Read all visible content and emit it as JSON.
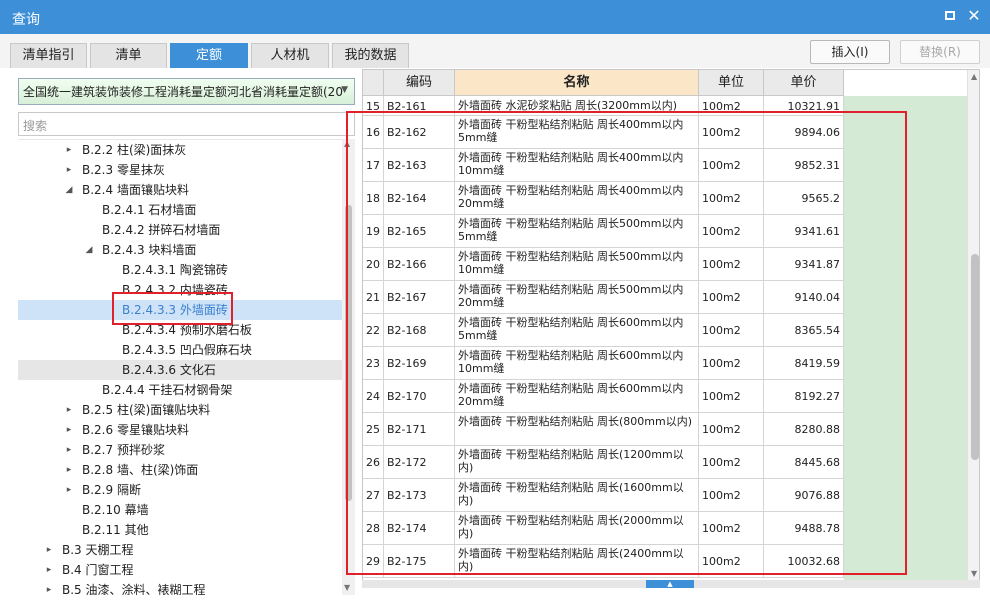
{
  "window": {
    "title": "查询"
  },
  "tabs": [
    {
      "label": "清单指引",
      "active": false
    },
    {
      "label": "清单",
      "active": false
    },
    {
      "label": "定额",
      "active": true
    },
    {
      "label": "人材机",
      "active": false
    },
    {
      "label": "我的数据",
      "active": false
    }
  ],
  "actions": {
    "insert_label": "插入(I)",
    "replace_label": "替换(R)"
  },
  "library": {
    "selected": "全国统一建筑装饰装修工程消耗量定额河北省消耗量定额(20"
  },
  "search": {
    "placeholder": "搜索"
  },
  "tree": [
    {
      "label": "B.2.2 柱(梁)面抹灰",
      "caret": "▸",
      "level": 2
    },
    {
      "label": "B.2.3 零星抹灰",
      "caret": "▸",
      "level": 2
    },
    {
      "label": "B.2.4 墙面镶贴块料",
      "caret": "◢",
      "level": 2
    },
    {
      "label": "B.2.4.1 石材墙面",
      "caret": "",
      "level": 3
    },
    {
      "label": "B.2.4.2 拼碎石材墙面",
      "caret": "",
      "level": 3
    },
    {
      "label": "B.2.4.3 块料墙面",
      "caret": "◢",
      "level": 3
    },
    {
      "label": "B.2.4.3.1 陶瓷锦砖",
      "caret": "",
      "level": 4
    },
    {
      "label": "B.2.4.3.2 内墙瓷砖",
      "caret": "",
      "level": 4
    },
    {
      "label": "B.2.4.3.3 外墙面砖",
      "caret": "",
      "level": 4,
      "selected": true
    },
    {
      "label": "B.2.4.3.4 预制水磨石板",
      "caret": "",
      "level": 4
    },
    {
      "label": "B.2.4.3.5 凹凸假麻石块",
      "caret": "",
      "level": 4
    },
    {
      "label": "B.2.4.3.6 文化石",
      "caret": "",
      "level": 4,
      "hover": true
    },
    {
      "label": "B.2.4.4 干挂石材钢骨架",
      "caret": "",
      "level": 3
    },
    {
      "label": "B.2.5 柱(梁)面镶贴块料",
      "caret": "▸",
      "level": 2
    },
    {
      "label": "B.2.6 零星镶贴块料",
      "caret": "▸",
      "level": 2
    },
    {
      "label": "B.2.7 预拌砂浆",
      "caret": "▸",
      "level": 2
    },
    {
      "label": "B.2.8 墙、柱(梁)饰面",
      "caret": "▸",
      "level": 2
    },
    {
      "label": "B.2.9 隔断",
      "caret": "▸",
      "level": 2
    },
    {
      "label": "B.2.10 幕墙",
      "caret": "",
      "level": 2
    },
    {
      "label": "B.2.11 其他",
      "caret": "",
      "level": 2
    },
    {
      "label": "B.3 天棚工程",
      "caret": "▸",
      "level": 1
    },
    {
      "label": "B.4 门窗工程",
      "caret": "▸",
      "level": 1
    },
    {
      "label": "B.5 油漆、涂料、裱糊工程",
      "caret": "▸",
      "level": 1
    }
  ],
  "grid": {
    "columns": [
      "",
      "编码",
      "名称",
      "单位",
      "单价"
    ],
    "rows": [
      {
        "no": "15",
        "code": "B2-161",
        "name": "外墙面砖 水泥砂浆粘贴 周长(3200mm以内)",
        "unit": "100m2",
        "price": "10321.91"
      },
      {
        "no": "16",
        "code": "B2-162",
        "name": "外墙面砖 干粉型粘结剂粘贴 周长400mm以内 5mm缝",
        "unit": "100m2",
        "price": "9894.06"
      },
      {
        "no": "17",
        "code": "B2-163",
        "name": "外墙面砖 干粉型粘结剂粘贴 周长400mm以内 10mm缝",
        "unit": "100m2",
        "price": "9852.31"
      },
      {
        "no": "18",
        "code": "B2-164",
        "name": "外墙面砖 干粉型粘结剂粘贴 周长400mm以内 20mm缝",
        "unit": "100m2",
        "price": "9565.2"
      },
      {
        "no": "19",
        "code": "B2-165",
        "name": "外墙面砖 干粉型粘结剂粘贴 周长500mm以内 5mm缝",
        "unit": "100m2",
        "price": "9341.61"
      },
      {
        "no": "20",
        "code": "B2-166",
        "name": "外墙面砖 干粉型粘结剂粘贴 周长500mm以内 10mm缝",
        "unit": "100m2",
        "price": "9341.87"
      },
      {
        "no": "21",
        "code": "B2-167",
        "name": "外墙面砖 干粉型粘结剂粘贴 周长500mm以内 20mm缝",
        "unit": "100m2",
        "price": "9140.04"
      },
      {
        "no": "22",
        "code": "B2-168",
        "name": "外墙面砖 干粉型粘结剂粘贴 周长600mm以内 5mm缝",
        "unit": "100m2",
        "price": "8365.54"
      },
      {
        "no": "23",
        "code": "B2-169",
        "name": "外墙面砖 干粉型粘结剂粘贴 周长600mm以内 10mm缝",
        "unit": "100m2",
        "price": "8419.59"
      },
      {
        "no": "24",
        "code": "B2-170",
        "name": "外墙面砖 干粉型粘结剂粘贴 周长600mm以内 20mm缝",
        "unit": "100m2",
        "price": "8192.27"
      },
      {
        "no": "25",
        "code": "B2-171",
        "name": "外墙面砖 干粉型粘结剂粘贴 周长(800mm以内)",
        "unit": "100m2",
        "price": "8280.88"
      },
      {
        "no": "26",
        "code": "B2-172",
        "name": "外墙面砖 干粉型粘结剂粘贴 周长(1200mm以内)",
        "unit": "100m2",
        "price": "8445.68"
      },
      {
        "no": "27",
        "code": "B2-173",
        "name": "外墙面砖 干粉型粘结剂粘贴 周长(1600mm以内)",
        "unit": "100m2",
        "price": "9076.88"
      },
      {
        "no": "28",
        "code": "B2-174",
        "name": "外墙面砖 干粉型粘结剂粘贴 周长(2000mm以内)",
        "unit": "100m2",
        "price": "9488.78"
      },
      {
        "no": "29",
        "code": "B2-175",
        "name": "外墙面砖 干粉型粘结剂粘贴 周长(2400mm以内)",
        "unit": "100m2",
        "price": "10032.68"
      }
    ]
  },
  "icons": {
    "maximize": "maximize-icon",
    "close": "close-icon",
    "dropdown": "chevron-down-icon"
  },
  "colors": {
    "accent": "#3d8fd8",
    "highlight": "#e0202a",
    "selected_bg": "#cfe3f8",
    "price_col_bg": "#d4ead4"
  }
}
